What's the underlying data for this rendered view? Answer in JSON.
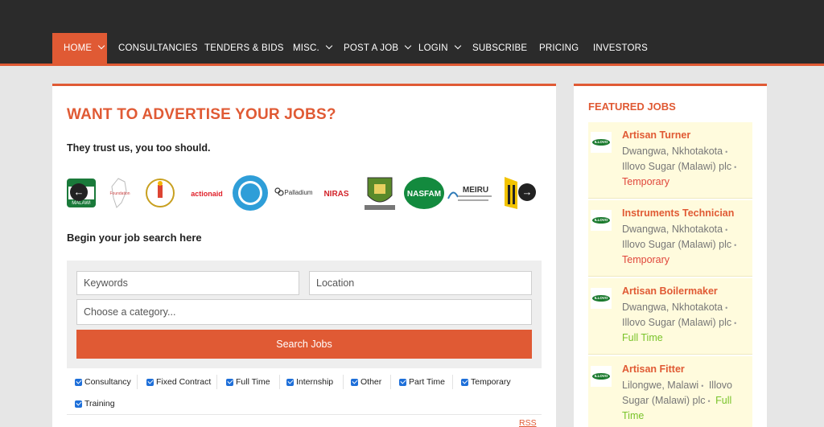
{
  "nav": {
    "items": [
      {
        "label": "HOME",
        "dropdown": true
      },
      {
        "label": "CONSULTANCIES",
        "dropdown": false
      },
      {
        "label": "TENDERS & BIDS",
        "dropdown": false
      },
      {
        "label": "MISC.",
        "dropdown": true
      },
      {
        "label": "POST A JOB",
        "dropdown": true
      },
      {
        "label": "LOGIN",
        "dropdown": true
      },
      {
        "label": "SUBSCRIBE",
        "dropdown": false
      },
      {
        "label": "PRICING",
        "dropdown": false
      },
      {
        "label": "INVESTORS",
        "dropdown": false
      }
    ]
  },
  "main": {
    "title": "WANT TO ADVERTISE YOUR JOBS?",
    "trust_text": "They trust us, you too should.",
    "logos": [
      {
        "name": "Clinton Health Access Initiative",
        "text": "MALAWI"
      },
      {
        "name": "Foundation",
        "text": "Foundation"
      },
      {
        "name": "Candle organization",
        "text": ""
      },
      {
        "name": "ActionAid",
        "text": "actionaid"
      },
      {
        "name": "Concern",
        "text": ""
      },
      {
        "name": "Palladium",
        "text": "Palladium"
      },
      {
        "name": "NIRAS",
        "text": "NIRAS"
      },
      {
        "name": "School crest",
        "text": ""
      },
      {
        "name": "NASFAM",
        "text": "NASFAM"
      },
      {
        "name": "MEIRU",
        "text": "MEIRU"
      },
      {
        "name": "Institution",
        "text": ""
      }
    ],
    "search_heading": "Begin your job search here",
    "search": {
      "keywords_placeholder": "Keywords",
      "location_placeholder": "Location",
      "category_placeholder": "Choose a category...",
      "button_label": "Search Jobs"
    },
    "filters": [
      "Consultancy",
      "Fixed Contract",
      "Full Time",
      "Internship",
      "Other",
      "Part Time",
      "Temporary",
      "Training"
    ],
    "rss_label": "RSS"
  },
  "sidebar": {
    "title": "FEATURED JOBS",
    "logo_text": "ILLOVO",
    "jobs": [
      {
        "title": "Artisan Turner",
        "location": "Dwangwa, Nkhotakota",
        "company": "Illovo Sugar (Malawi) plc",
        "type": "Temporary"
      },
      {
        "title": "Instruments Technician",
        "location": "Dwangwa, Nkhotakota",
        "company": "Illovo Sugar (Malawi) plc",
        "type": "Temporary"
      },
      {
        "title": "Artisan Boilermaker",
        "location": "Dwangwa, Nkhotakota",
        "company": "Illovo Sugar (Malawi) plc",
        "type": "Full Time"
      },
      {
        "title": "Artisan Fitter",
        "location": "Lilongwe, Malawi",
        "company": "Illovo Sugar (Malawi) plc",
        "type": "Full Time"
      }
    ]
  },
  "colors": {
    "accent": "#e05a34",
    "nav_bg": "#2b2b2b",
    "featured_bg": "#fffbdd",
    "temporary": "#e0463b",
    "full_time": "#79c32a"
  }
}
